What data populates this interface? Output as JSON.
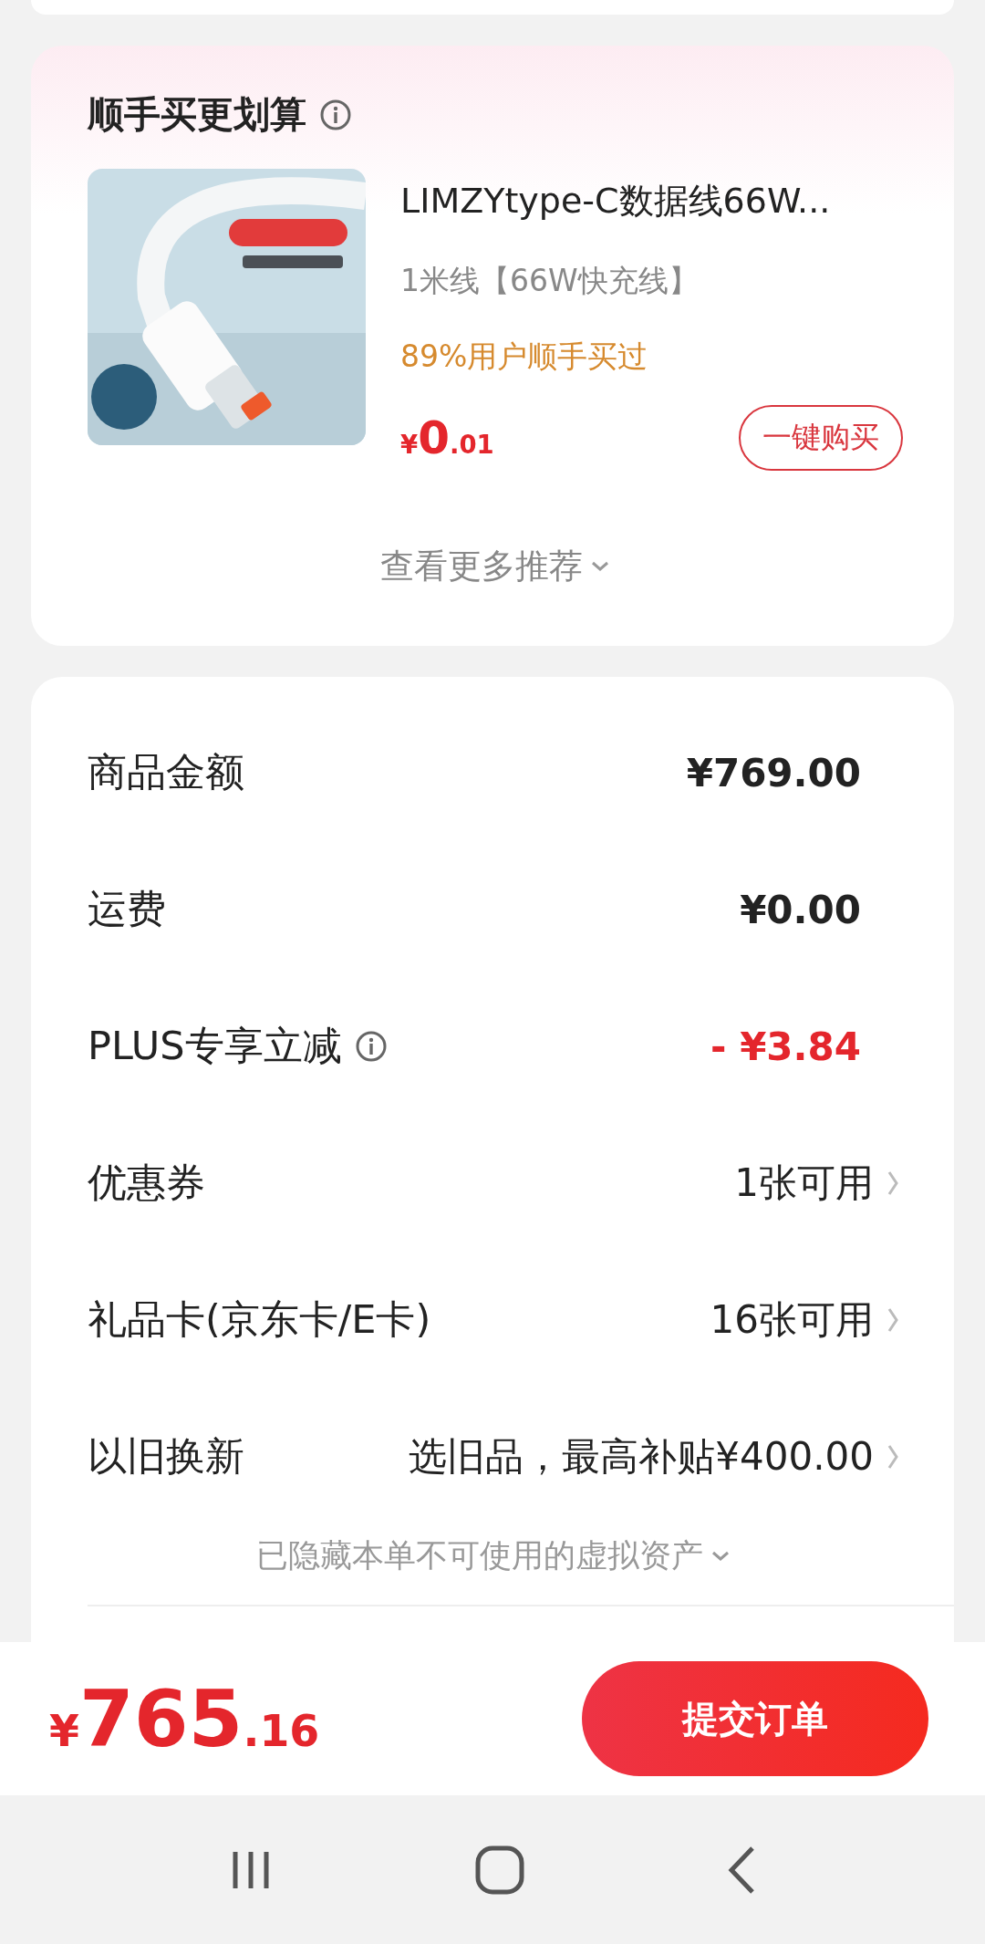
{
  "recommend": {
    "title": "顺手买更划算",
    "product": {
      "name": "LIMZYtype-C数据线66W...",
      "spec": "1米线【66W快充线】",
      "social_proof": "89%用户顺手买过",
      "price": {
        "symbol": "¥",
        "integer": "0",
        "decimal": ".01"
      },
      "buy_button": "一键购买"
    },
    "more": "查看更多推荐"
  },
  "summary": {
    "rows": [
      {
        "kind": "amount",
        "label": "商品金额",
        "value": "¥769.00",
        "info": false
      },
      {
        "kind": "amount",
        "label": "运费",
        "value": "¥0.00",
        "info": false
      },
      {
        "kind": "discount",
        "label": "PLUS专享立减",
        "value": "- ¥3.84",
        "info": true
      },
      {
        "kind": "select",
        "label": "优惠券",
        "value": "1张可用",
        "info": false
      },
      {
        "kind": "select",
        "label": "礼品卡(京东卡/E卡)",
        "value": "16张可用",
        "info": false
      },
      {
        "kind": "select",
        "label": "以旧换新",
        "value": "选旧品，最高补贴¥400.00",
        "info": false
      }
    ],
    "hidden_note": "已隐藏本单不可使用的虚拟资产"
  },
  "footer": {
    "total": {
      "symbol": "¥",
      "integer": "765",
      "decimal": ".16"
    },
    "submit": "提交订单"
  }
}
